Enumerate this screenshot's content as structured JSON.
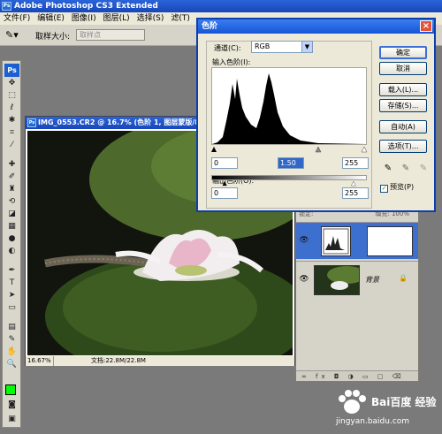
{
  "app": {
    "title": "Adobe Photoshop CS3 Extended",
    "logo_text": "Ps"
  },
  "menu": [
    "文件(F)",
    "编辑(E)",
    "图像(I)",
    "图层(L)",
    "选择(S)",
    "滤(T)"
  ],
  "options_bar": {
    "sample_size_label": "取样大小:",
    "sample_size_value": "取样点"
  },
  "document": {
    "title": "IMG_0553.CR2 @ 16.7% (色阶 1, 图层蒙版/8)",
    "zoom": "16.67%",
    "doc_info": "文档:22.8M/22.8M"
  },
  "levels_dialog": {
    "title": "色阶",
    "channel_label": "通道(C):",
    "channel_value": "RGB",
    "input_label": "输入色阶(I):",
    "input_black": "0",
    "input_gamma": "1.50",
    "input_white": "255",
    "output_label": "输出色阶(O):",
    "output_black": "0",
    "output_white": "255",
    "buttons": {
      "ok": "确定",
      "cancel": "取消",
      "load": "载入(L)...",
      "save": "存储(S)...",
      "auto": "自动(A)",
      "options": "选项(T)..."
    },
    "preview_label": "预览(P)",
    "preview_checked": true
  },
  "layers_panel": {
    "header_left": "锁定:",
    "header_right": "填充: 100%",
    "layers": [
      {
        "name": "",
        "type": "adjustment-levels",
        "visible": true,
        "selected": true
      },
      {
        "name": "背景",
        "type": "background",
        "visible": true,
        "locked": true
      }
    ]
  },
  "foreground_color": "#00ff00",
  "watermark": {
    "text": "Bai百度 经验",
    "url": "jingyan.baidu.com"
  }
}
